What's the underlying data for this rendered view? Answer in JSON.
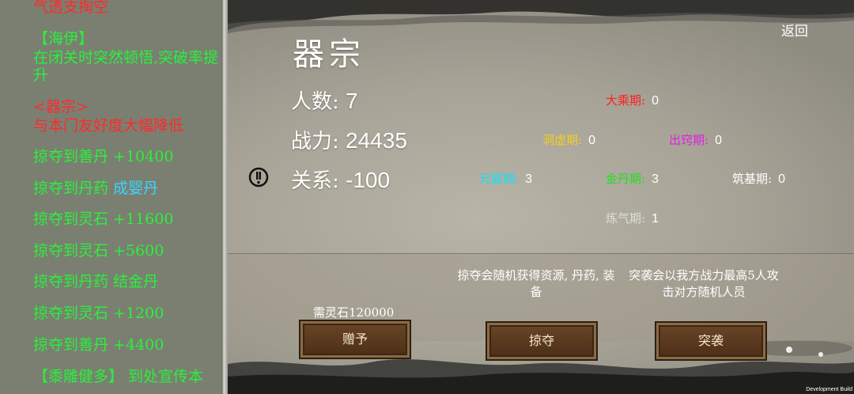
{
  "log": {
    "lines": [
      {
        "text": "气透支掏空",
        "color": "#ff2a2a"
      },
      {
        "text": "【海伊】",
        "color": "#27f23a"
      },
      {
        "text": "在闭关时突然顿悟,突破率提升",
        "color": "#27f23a"
      },
      {
        "text": "<器宗>",
        "color": "#ff2a2a"
      },
      {
        "text": "与本门友好度大幅降低",
        "color": "#ff2a2a"
      },
      {
        "text": "掠夺到丹药 ",
        "color": "#27f23a",
        "extra": "成婴丹",
        "extra_color": "#37d6ff"
      }
    ],
    "plunder_lines": [
      {
        "text": "掠夺到善丹 +10400"
      },
      {
        "text": "掠夺到灵石 +11600"
      },
      {
        "text": "掠夺到灵石 +5600"
      },
      {
        "text": "掠夺到丹药 结金丹"
      },
      {
        "text": "掠夺到灵石 +1200"
      },
      {
        "text": "掠夺到善丹 +4400"
      },
      {
        "text": "【黍雕健多】 到处宣传本"
      }
    ],
    "green": "#27f23a"
  },
  "sect": {
    "name": "器宗",
    "population_label": "人数:",
    "population": "7",
    "power_label": "战力:",
    "power": "24435",
    "relation_label": "关系:",
    "relation": "-100"
  },
  "realms": [
    {
      "name": "大乘期:",
      "count": "0",
      "color": "#ff2020"
    },
    {
      "name": "洞虚期:",
      "count": "0",
      "color": "#f0d020"
    },
    {
      "name": "出窍期:",
      "count": "0",
      "color": "#e020e0"
    },
    {
      "name": "元婴期:",
      "count": "3",
      "color": "#10e0ff"
    },
    {
      "name": "金丹期:",
      "count": "3",
      "color": "#20e020"
    },
    {
      "name": "筑基期:",
      "count": "0",
      "color": "#ffffff"
    },
    {
      "name": "炼气期:",
      "count": "1",
      "color": "#dddddd"
    }
  ],
  "actions": {
    "plunder_desc": "掠夺会随机获得资源, 丹药, 装备",
    "raid_desc": "突袭会以我方战力最高5人攻击对方随机人员",
    "cost": "需灵石120000",
    "gift_label": "赠予",
    "plunder_label": "掠夺",
    "raid_label": "突袭"
  },
  "back_label": "返回",
  "dev_build": "Development Build",
  "icons": {
    "relation": "exclamation-circle-icon"
  }
}
